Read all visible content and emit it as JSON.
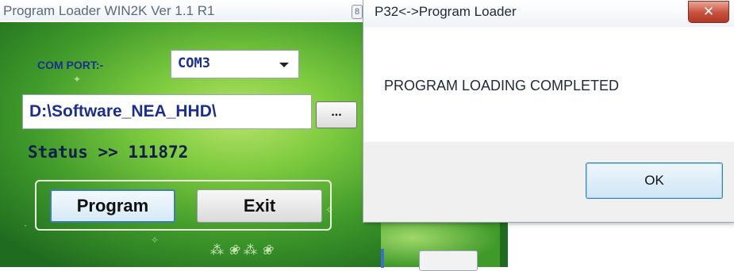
{
  "loader": {
    "title": "Program Loader WIN2K Ver 1.1 R1",
    "title_stub": "8",
    "com_label": "COM PORT:-",
    "com_value": "COM3",
    "path_value": "D:\\Software_NEA_HHD\\",
    "browse_label": "...",
    "status": "Status >> 111872",
    "program_label": "Program",
    "exit_label": "Exit"
  },
  "dialog": {
    "title": "P32<->Program Loader",
    "close_label": "✕",
    "message": "PROGRAM LOADING COMPLETED",
    "ok_label": "OK"
  },
  "colors": {
    "label_blue": "#1a2f8f",
    "close_red": "#c7503c",
    "accent_blue": "#3c7fb1"
  }
}
